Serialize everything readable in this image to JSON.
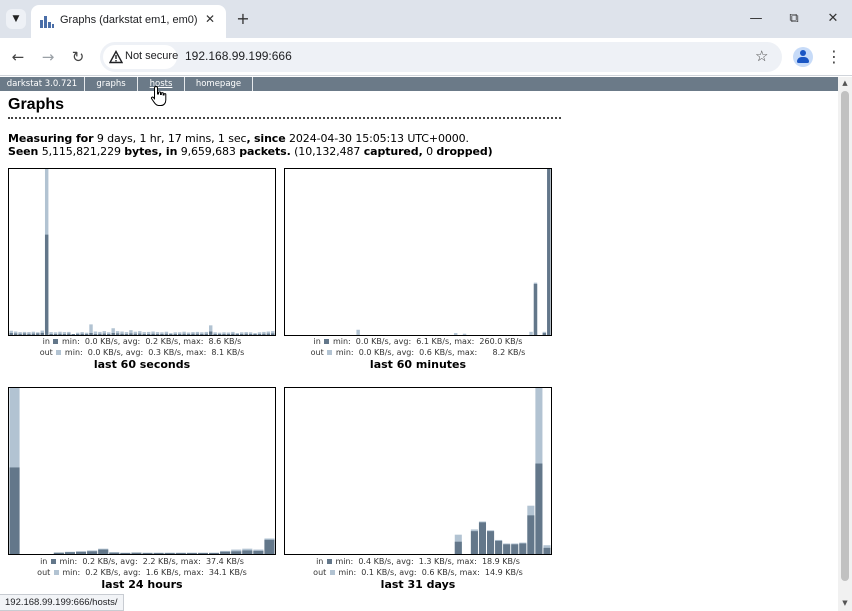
{
  "browser": {
    "tab_title": "Graphs (darkstat em1, em0)",
    "security_label": "Not secure",
    "url": "192.168.99.199:666",
    "status_url": "192.168.99.199:666/hosts/"
  },
  "nav": {
    "items": [
      "darkstat 3.0.721",
      "graphs",
      "hosts",
      "homepage"
    ]
  },
  "page": {
    "title": "Graphs",
    "measuring_label": "Measuring for",
    "measuring_value": "9 days, 1 hr, 17 mins, 1 sec",
    "since_label": "since",
    "since_value": "2024-04-30 15:05:13 UTC+0000.",
    "seen_label": "Seen",
    "bytes_value": "5,115,821,229",
    "bytes_label": "bytes, in",
    "packets_value": "9,659,683",
    "packets_label": "packets.",
    "captured_value": "(10,132,487",
    "captured_label": "captured,",
    "dropped_value": "0",
    "dropped_label": "dropped)"
  },
  "colors": {
    "in": "#63778a",
    "out": "#b2c3d2"
  },
  "graphs": [
    {
      "caption": "last 60 seconds",
      "in_stats": "in ■ min:  0.0 KB/s, avg:  0.2 KB/s, max:  8.6 KB/s",
      "out_stats": "out ■ min:  0.0 KB/s, avg:  0.3 KB/s, max:  8.1 KB/s",
      "in_label": "in",
      "out_label": "out",
      "in_text": "min:  0.0 KB/s, avg:  0.2 KB/s, max:  8.6 KB/s",
      "out_text": "min:  0.0 KB/s, avg:  0.3 KB/s, max:  8.1 KB/s"
    },
    {
      "caption": "last 60 minutes",
      "in_label": "in",
      "out_label": "out",
      "in_text": "min:  0.0 KB/s, avg:  6.1 KB/s, max:  260.0 KB/s",
      "out_text": "min:  0.0 KB/s, avg:  0.6 KB/s, max:      8.2 KB/s"
    },
    {
      "caption": "last 24 hours",
      "in_label": "in",
      "out_label": "out",
      "in_text": "min:  0.2 KB/s, avg:  2.2 KB/s, max:  37.4 KB/s",
      "out_text": "min:  0.2 KB/s, avg:  1.6 KB/s, max:  34.1 KB/s"
    },
    {
      "caption": "last 31 days",
      "in_label": "in",
      "out_label": "out",
      "in_text": "min:  0.4 KB/s, avg:  1.3 KB/s, max:  18.9 KB/s",
      "out_text": "min:  0.1 KB/s, avg:  0.6 KB/s, max:  14.9 KB/s"
    }
  ],
  "chart_data": [
    {
      "type": "bar",
      "title": "last 60 seconds",
      "unit": "KB/s",
      "ymax": 8.6,
      "series": [
        {
          "name": "in",
          "values": [
            0.1,
            0.08,
            0.06,
            0.08,
            0.06,
            0.07,
            0.08,
            0.11,
            5.2,
            0.05,
            0.05,
            0.06,
            0.05,
            0.07,
            0.03,
            0.05,
            0.06,
            0.05,
            0.1,
            0.05,
            0.06,
            0.07,
            0.05,
            0.1,
            0.08,
            0.06,
            0.05,
            0.08,
            0.06,
            0.07,
            0.05,
            0.05,
            0.06,
            0.05,
            0.05,
            0.06,
            0.04,
            0.05,
            0.05,
            0.06,
            0.05,
            0.06,
            0.06,
            0.05,
            0.06,
            0.18,
            0.05,
            0.04,
            0.05,
            0.05,
            0.06,
            0.04,
            0.05,
            0.06,
            0.05,
            0.04,
            0.05,
            0.06,
            0.07,
            0.08
          ]
        },
        {
          "name": "out",
          "values": [
            0.22,
            0.18,
            0.15,
            0.16,
            0.15,
            0.17,
            0.14,
            0.23,
            8.6,
            0.15,
            0.14,
            0.17,
            0.15,
            0.16,
            0.05,
            0.12,
            0.15,
            0.12,
            0.55,
            0.18,
            0.16,
            0.2,
            0.14,
            0.35,
            0.2,
            0.18,
            0.15,
            0.25,
            0.17,
            0.2,
            0.15,
            0.16,
            0.18,
            0.15,
            0.14,
            0.17,
            0.1,
            0.14,
            0.14,
            0.17,
            0.13,
            0.15,
            0.16,
            0.14,
            0.16,
            0.5,
            0.14,
            0.12,
            0.14,
            0.13,
            0.16,
            0.1,
            0.14,
            0.15,
            0.14,
            0.1,
            0.14,
            0.16,
            0.18,
            0.2
          ]
        }
      ]
    },
    {
      "type": "bar",
      "title": "last 60 minutes",
      "unit": "KB/s",
      "ymax": 260.0,
      "series": [
        {
          "name": "in",
          "values": [
            0,
            0,
            0,
            0,
            0,
            0,
            0,
            0,
            0,
            0,
            0,
            0,
            0,
            0,
            0,
            0,
            0,
            0,
            0,
            0,
            0,
            0,
            0,
            0,
            0,
            0,
            0,
            0,
            0,
            0,
            0,
            0,
            0,
            0,
            0,
            0,
            0,
            0,
            0,
            0,
            0,
            0,
            0,
            0,
            0,
            0,
            0,
            0,
            0,
            0,
            0,
            0,
            0,
            0,
            0,
            0,
            80,
            0,
            3,
            260
          ]
        },
        {
          "name": "out",
          "values": [
            0,
            0,
            0,
            0,
            0,
            0,
            0,
            0,
            0,
            0,
            0,
            0,
            0,
            0,
            0,
            0,
            8.2,
            0,
            0,
            0,
            0,
            0,
            0,
            0,
            0,
            0,
            0,
            0,
            0,
            0,
            0,
            0,
            0,
            0,
            0,
            0,
            0,
            0,
            3,
            0,
            2,
            0,
            0,
            0,
            0,
            0,
            0,
            0,
            0,
            0,
            0,
            0,
            0,
            0,
            0,
            5,
            82,
            0,
            5,
            255
          ]
        }
      ]
    },
    {
      "type": "bar",
      "title": "last 24 hours",
      "unit": "KB/s",
      "ymax": 37.4,
      "series": [
        {
          "name": "in",
          "values": [
            19.5,
            0,
            0,
            0,
            0.3,
            0.4,
            0.5,
            0.6,
            1.0,
            0.3,
            0.2,
            0.3,
            0.2,
            0.2,
            0.2,
            0.2,
            0.2,
            0.2,
            0.2,
            0.5,
            0.6,
            0.8,
            0.7,
            3.2
          ]
        },
        {
          "name": "out",
          "values": [
            37.4,
            0,
            0,
            0,
            0.3,
            0.5,
            0.6,
            0.8,
            1.2,
            0.4,
            0.3,
            0.3,
            0.3,
            0.3,
            0.3,
            0.3,
            0.3,
            0.3,
            0.3,
            0.7,
            1.0,
            1.2,
            1.0,
            3.5
          ]
        }
      ]
    },
    {
      "type": "bar",
      "title": "last 31 days",
      "unit": "KB/s",
      "ymax": 18.9,
      "series": [
        {
          "name": "in",
          "values": [
            0,
            0,
            0,
            0,
            0,
            0,
            0,
            0,
            0,
            0,
            0,
            0,
            0,
            0,
            0,
            0,
            0,
            0,
            0,
            0,
            0,
            1.4,
            0,
            2.6,
            3.6,
            2.6,
            1.5,
            1.1,
            1.1,
            1.2,
            4.4,
            10.3,
            0.7
          ]
        },
        {
          "name": "out",
          "values": [
            0,
            0,
            0,
            0,
            0,
            0,
            0,
            0,
            0,
            0,
            0,
            0,
            0,
            0,
            0,
            0,
            0,
            0,
            0,
            0,
            0,
            2.2,
            0,
            2.8,
            3.7,
            2.7,
            1.6,
            1.2,
            1.2,
            1.3,
            5.5,
            18.9,
            1.0
          ]
        }
      ]
    }
  ]
}
